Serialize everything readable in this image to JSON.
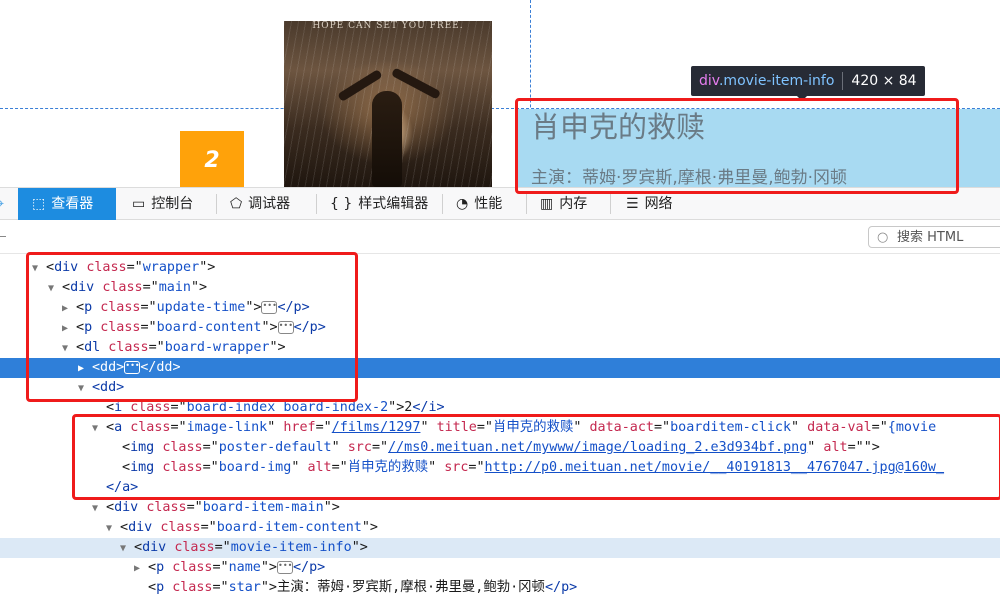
{
  "preview": {
    "poster_tagline": "HOPE CAN SET YOU FREE.",
    "board_index": "2",
    "tooltip": {
      "tag": "div",
      "class": ".movie-item-info",
      "size": "420 × 84"
    },
    "movie_name": "肖申克的救赎",
    "movie_star": "主演：蒂姆·罗宾斯,摩根·弗里曼,鲍勃·冈顿",
    "highlight_color": "#a8daf2",
    "badge_color": "#ffa20a"
  },
  "devtools": {
    "tabs": [
      {
        "label": "查看器",
        "icon": "inspector-icon"
      },
      {
        "label": "控制台",
        "icon": "console-icon"
      },
      {
        "label": "调试器",
        "icon": "debugger-icon"
      },
      {
        "label": "样式编辑器",
        "icon": "style-editor-icon"
      },
      {
        "label": "性能",
        "icon": "performance-icon"
      },
      {
        "label": "内存",
        "icon": "memory-icon"
      },
      {
        "label": "网络",
        "icon": "network-icon"
      }
    ],
    "search_placeholder": "搜索 HTML",
    "accent_color": "#1d8ce0",
    "html_tree": {
      "r0": {
        "tag": "div",
        "attr": "class",
        "val": "wrapper"
      },
      "r1": {
        "tag": "div",
        "attr": "class",
        "val": "main"
      },
      "r2": {
        "tag": "p",
        "attr": "class",
        "val": "update-time",
        "close": "</p>"
      },
      "r3": {
        "tag": "p",
        "attr": "class",
        "val": "board-content",
        "close": "</p>"
      },
      "r4": {
        "tag": "dl",
        "attr": "class",
        "val": "board-wrapper"
      },
      "r5": {
        "open": "<dd>",
        "close": "</dd>"
      },
      "r6": {
        "open": "<dd>"
      },
      "r7": {
        "tag": "i",
        "attr": "class",
        "val": "board-index board-index-2",
        "text": "2",
        "close": "</i>"
      },
      "r8": {
        "tag": "a",
        "attr1": "class",
        "val1": "image-link",
        "attr2": "href",
        "val2": "/films/1297",
        "attr3": "title",
        "val3": "肖申克的救赎",
        "attr4": "data-act",
        "val4": "boarditem-click",
        "attr5": "data-val",
        "val5": "{movie"
      },
      "r9": {
        "tag": "img",
        "attr1": "class",
        "val1": "poster-default",
        "attr2": "src",
        "val2": "//ms0.meituan.net/mywww/image/loading_2.e3d934bf.png",
        "attr3": "alt",
        "val3": ""
      },
      "r10": {
        "tag": "img",
        "attr1": "class",
        "val1": "board-img",
        "attr2": "alt",
        "val2": "肖申克的救赎",
        "attr3": "src",
        "val3": "http://p0.meituan.net/movie/__40191813__4767047.jpg@160w_"
      },
      "r11": {
        "close": "</a>"
      },
      "r12": {
        "tag": "div",
        "attr": "class",
        "val": "board-item-main"
      },
      "r13": {
        "tag": "div",
        "attr": "class",
        "val": "board-item-content"
      },
      "r14": {
        "tag": "div",
        "attr": "class",
        "val": "movie-item-info"
      },
      "r15": {
        "tag": "p",
        "attr": "class",
        "val": "name",
        "close": "</p>"
      },
      "r16": {
        "tag": "p",
        "attr": "class",
        "val": "star",
        "text": "主演：蒂姆·罗宾斯,摩根·弗里曼,鲍勃·冈顿",
        "close": "</p>"
      }
    }
  }
}
